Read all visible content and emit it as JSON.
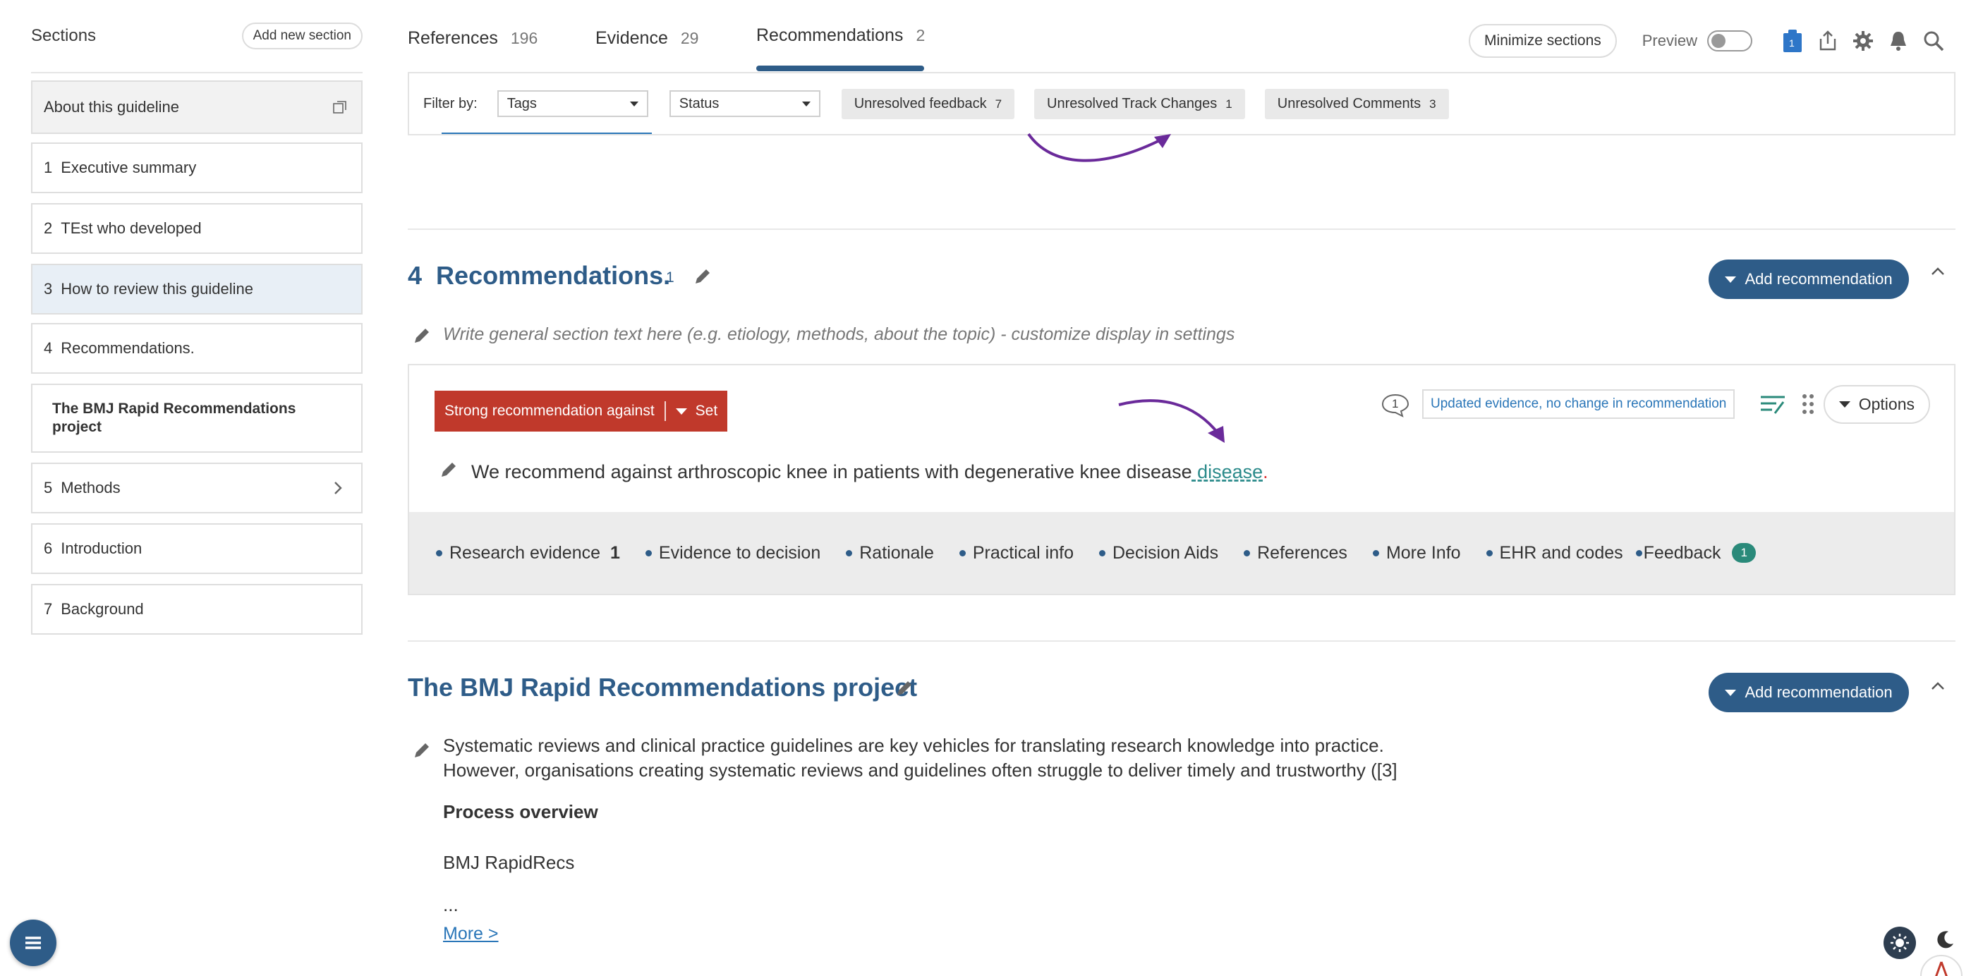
{
  "sidebar": {
    "title": "Sections",
    "add_button": "Add new section",
    "items": [
      {
        "num": "",
        "label": "About this guideline"
      },
      {
        "num": "1",
        "label": "Executive summary"
      },
      {
        "num": "2",
        "label": "TEst who developed"
      },
      {
        "num": "3",
        "label": "How to review this guideline"
      },
      {
        "num": "4",
        "label": "Recommendations."
      },
      {
        "num": "",
        "label": "The BMJ Rapid Recommendations project"
      },
      {
        "num": "5",
        "label": "Methods"
      },
      {
        "num": "6",
        "label": "Introduction"
      },
      {
        "num": "7",
        "label": "Background"
      }
    ]
  },
  "tabs": [
    {
      "label": "References",
      "count": "196"
    },
    {
      "label": "Evidence",
      "count": "29"
    },
    {
      "label": "Recommendations",
      "count": "2"
    }
  ],
  "topbar": {
    "minimize": "Minimize sections",
    "preview": "Preview",
    "notification_count": "1"
  },
  "filter": {
    "label": "Filter by:",
    "tags": "Tags",
    "status": "Status",
    "chips": [
      {
        "label": "Unresolved feedback",
        "count": "7"
      },
      {
        "label": "Unresolved Track Changes",
        "count": "1"
      },
      {
        "label": "Unresolved Comments",
        "count": "3"
      }
    ]
  },
  "section4": {
    "num": "4",
    "title": "Recommendations.",
    "count": "1",
    "add_button": "Add recommendation",
    "placeholder": "Write general section text here (e.g. etiology, methods, about the topic) - customize display in settings"
  },
  "recommendation": {
    "strength": "Strong recommendation against",
    "set": "Set",
    "comment_count": "1",
    "update_tag": "Updated evidence, no change in recommendation",
    "options": "Options",
    "text": "We recommend against arthroscopic knee  in patients with degenerative knee disease",
    "inserted": " disease",
    "deleted": ".",
    "tabs": [
      {
        "label": "Research evidence",
        "count": "1"
      },
      {
        "label": "Evidence to decision",
        "count": ""
      },
      {
        "label": "Rationale",
        "count": ""
      },
      {
        "label": "Practical info",
        "count": ""
      },
      {
        "label": "Decision Aids",
        "count": ""
      },
      {
        "label": "References",
        "count": ""
      },
      {
        "label": "More Info",
        "count": ""
      },
      {
        "label": "EHR and codes",
        "count": ""
      }
    ],
    "feedback_label": "Feedback",
    "feedback_count": "1"
  },
  "bmj_section": {
    "title": "The BMJ Rapid Recommendations project",
    "add_button": "Add recommendation",
    "line1": "Systematic reviews and clinical practice guidelines are key vehicles for translating research knowledge into practice.",
    "line2": "However, organisations creating systematic reviews and guidelines often struggle to deliver timely and trustworthy ([3]",
    "process_heading": "Process overview",
    "bmj_text": "BMJ RapidRecs",
    "ellipsis": "...",
    "more_link": "More >"
  },
  "colors": {
    "primary": "#2e5c88",
    "strong_against": "#c0392b",
    "link": "#2a76b8",
    "annotation_arrow": "#6a2a9a",
    "feedback_badge": "#2a8a7a"
  }
}
